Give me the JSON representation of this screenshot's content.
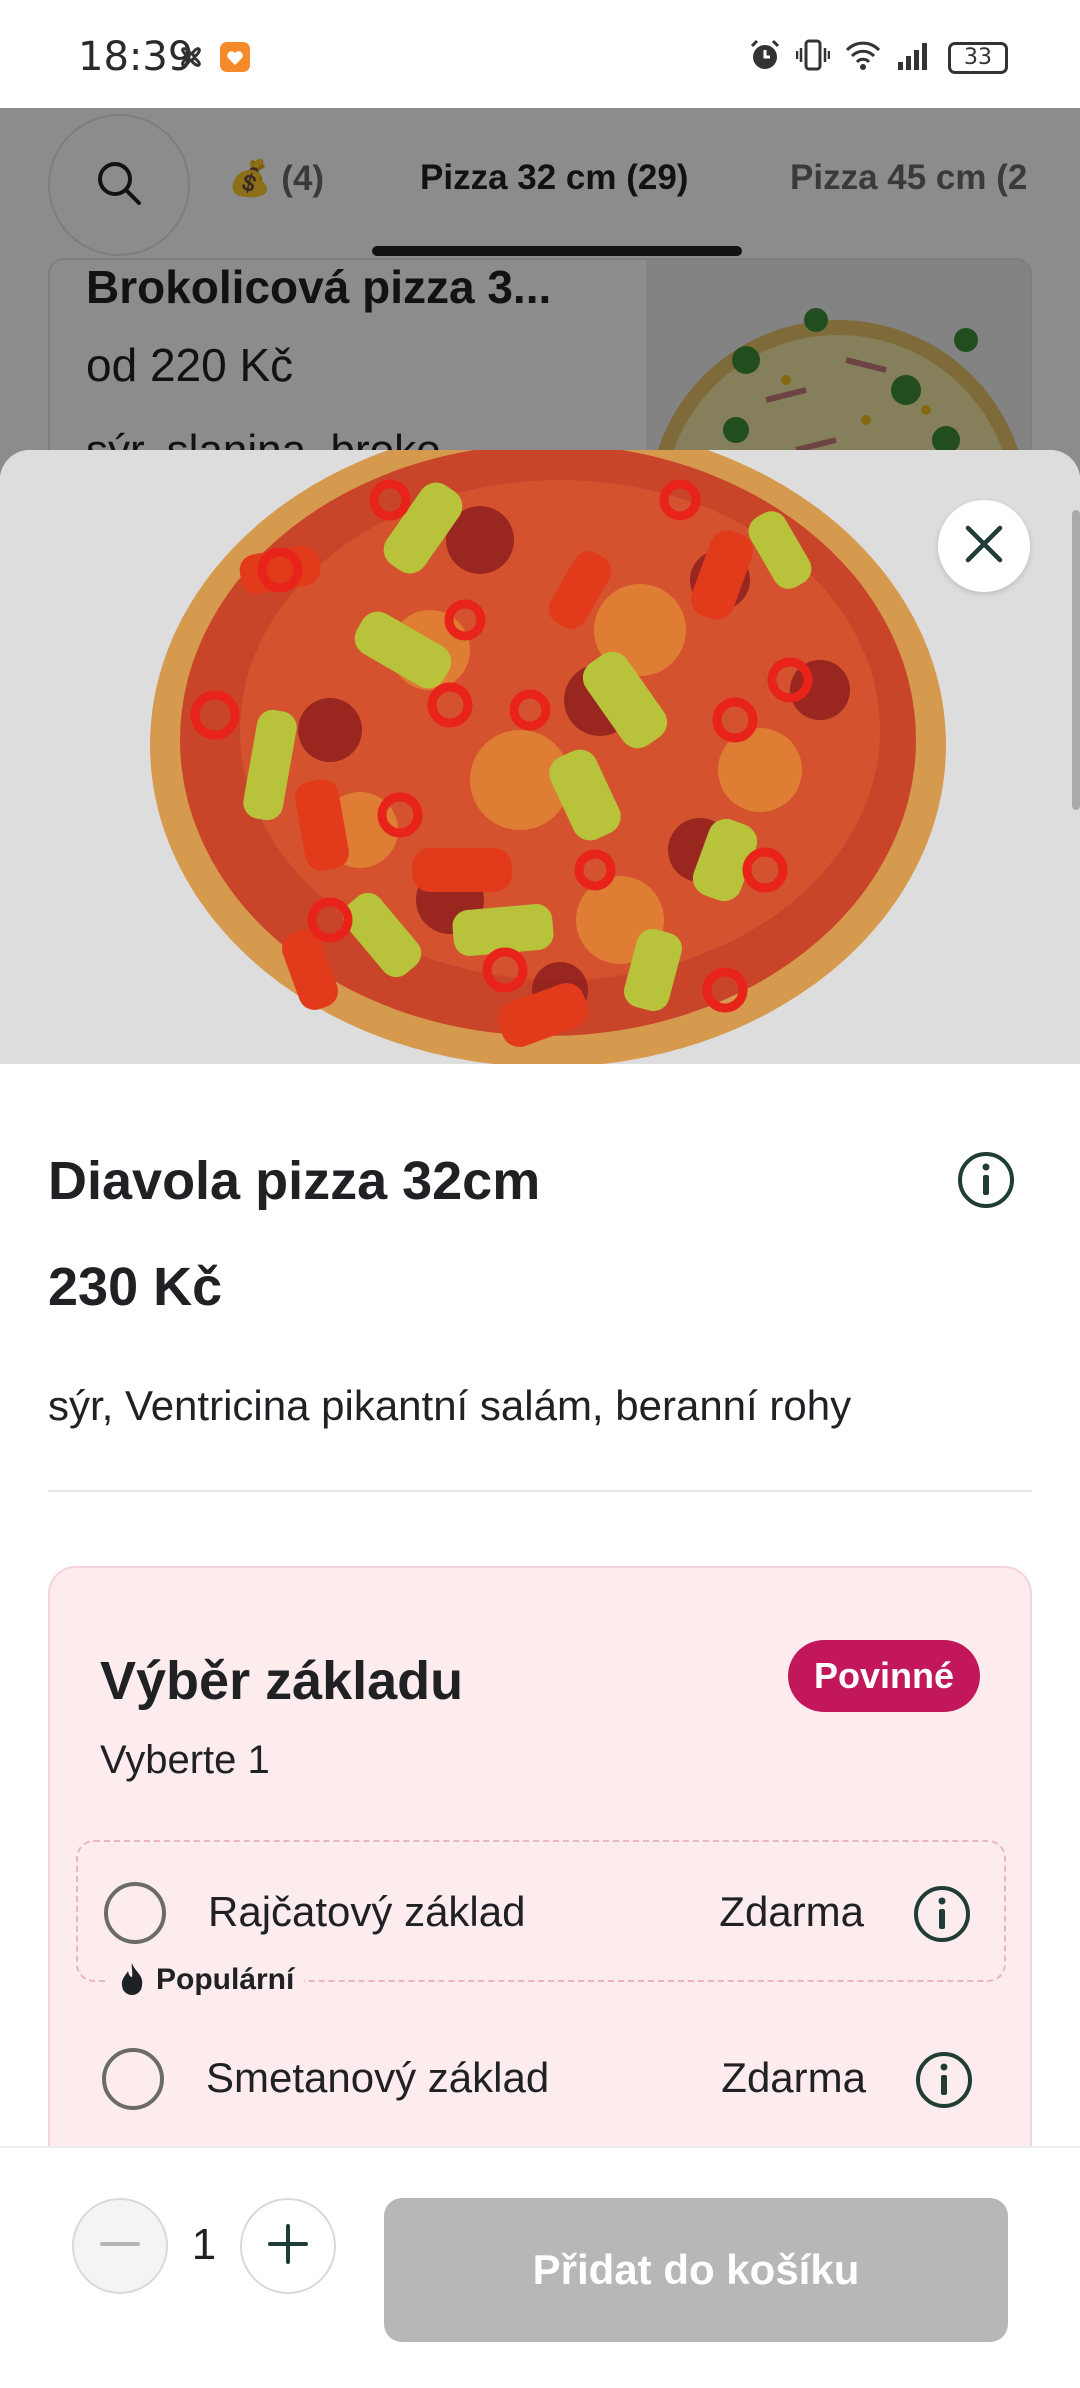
{
  "status_bar": {
    "time": "18:39",
    "battery": "33",
    "icons": [
      "fan-icon",
      "shield-icon",
      "alarm-icon",
      "vibrate-icon",
      "wifi-icon",
      "signal-icon",
      "battery-icon"
    ]
  },
  "background": {
    "tabs": [
      {
        "label": "💰 (4)"
      },
      {
        "label": "Pizza 32 cm (29)"
      },
      {
        "label": "Pizza 45 cm (2"
      }
    ],
    "active_tab": "Pizza 32 cm (29)",
    "card": {
      "title": "Brokolicová pizza 3...",
      "price": "od 220 Kč",
      "description": "sýr, slanina, broko..."
    }
  },
  "sheet": {
    "title": "Diavola pizza 32cm",
    "price": "230 Kč",
    "description": "sýr, Ventricina pikantní salám, beranní rohy",
    "options_group": {
      "title": "Výběr základu",
      "subtitle": "Vyberte 1",
      "badge": "Povinné",
      "items": [
        {
          "label": "Rajčatový základ",
          "price": "Zdarma",
          "tag": "Populární"
        },
        {
          "label": "Smetanový základ",
          "price": "Zdarma"
        }
      ]
    }
  },
  "bottom_bar": {
    "quantity": "1",
    "add_button": "Přidat do košíku"
  },
  "colors": {
    "accent_badge": "#c2185b",
    "options_bg": "#fdecee",
    "disabled_button": "#b7b7b7",
    "icon_dark": "#1f3d36"
  }
}
